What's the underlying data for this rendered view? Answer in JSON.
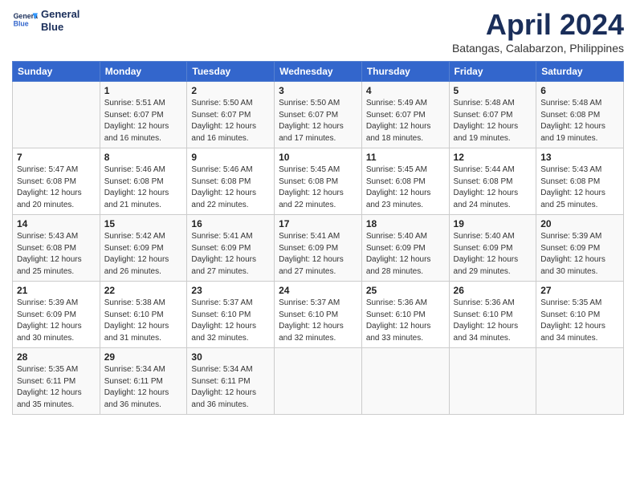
{
  "header": {
    "logo_line1": "General",
    "logo_line2": "Blue",
    "month": "April 2024",
    "location": "Batangas, Calabarzon, Philippines"
  },
  "days_of_week": [
    "Sunday",
    "Monday",
    "Tuesday",
    "Wednesday",
    "Thursday",
    "Friday",
    "Saturday"
  ],
  "weeks": [
    [
      {
        "num": "",
        "info": ""
      },
      {
        "num": "1",
        "info": "Sunrise: 5:51 AM\nSunset: 6:07 PM\nDaylight: 12 hours\nand 16 minutes."
      },
      {
        "num": "2",
        "info": "Sunrise: 5:50 AM\nSunset: 6:07 PM\nDaylight: 12 hours\nand 16 minutes."
      },
      {
        "num": "3",
        "info": "Sunrise: 5:50 AM\nSunset: 6:07 PM\nDaylight: 12 hours\nand 17 minutes."
      },
      {
        "num": "4",
        "info": "Sunrise: 5:49 AM\nSunset: 6:07 PM\nDaylight: 12 hours\nand 18 minutes."
      },
      {
        "num": "5",
        "info": "Sunrise: 5:48 AM\nSunset: 6:07 PM\nDaylight: 12 hours\nand 19 minutes."
      },
      {
        "num": "6",
        "info": "Sunrise: 5:48 AM\nSunset: 6:08 PM\nDaylight: 12 hours\nand 19 minutes."
      }
    ],
    [
      {
        "num": "7",
        "info": "Sunrise: 5:47 AM\nSunset: 6:08 PM\nDaylight: 12 hours\nand 20 minutes."
      },
      {
        "num": "8",
        "info": "Sunrise: 5:46 AM\nSunset: 6:08 PM\nDaylight: 12 hours\nand 21 minutes."
      },
      {
        "num": "9",
        "info": "Sunrise: 5:46 AM\nSunset: 6:08 PM\nDaylight: 12 hours\nand 22 minutes."
      },
      {
        "num": "10",
        "info": "Sunrise: 5:45 AM\nSunset: 6:08 PM\nDaylight: 12 hours\nand 22 minutes."
      },
      {
        "num": "11",
        "info": "Sunrise: 5:45 AM\nSunset: 6:08 PM\nDaylight: 12 hours\nand 23 minutes."
      },
      {
        "num": "12",
        "info": "Sunrise: 5:44 AM\nSunset: 6:08 PM\nDaylight: 12 hours\nand 24 minutes."
      },
      {
        "num": "13",
        "info": "Sunrise: 5:43 AM\nSunset: 6:08 PM\nDaylight: 12 hours\nand 25 minutes."
      }
    ],
    [
      {
        "num": "14",
        "info": "Sunrise: 5:43 AM\nSunset: 6:08 PM\nDaylight: 12 hours\nand 25 minutes."
      },
      {
        "num": "15",
        "info": "Sunrise: 5:42 AM\nSunset: 6:09 PM\nDaylight: 12 hours\nand 26 minutes."
      },
      {
        "num": "16",
        "info": "Sunrise: 5:41 AM\nSunset: 6:09 PM\nDaylight: 12 hours\nand 27 minutes."
      },
      {
        "num": "17",
        "info": "Sunrise: 5:41 AM\nSunset: 6:09 PM\nDaylight: 12 hours\nand 27 minutes."
      },
      {
        "num": "18",
        "info": "Sunrise: 5:40 AM\nSunset: 6:09 PM\nDaylight: 12 hours\nand 28 minutes."
      },
      {
        "num": "19",
        "info": "Sunrise: 5:40 AM\nSunset: 6:09 PM\nDaylight: 12 hours\nand 29 minutes."
      },
      {
        "num": "20",
        "info": "Sunrise: 5:39 AM\nSunset: 6:09 PM\nDaylight: 12 hours\nand 30 minutes."
      }
    ],
    [
      {
        "num": "21",
        "info": "Sunrise: 5:39 AM\nSunset: 6:09 PM\nDaylight: 12 hours\nand 30 minutes."
      },
      {
        "num": "22",
        "info": "Sunrise: 5:38 AM\nSunset: 6:10 PM\nDaylight: 12 hours\nand 31 minutes."
      },
      {
        "num": "23",
        "info": "Sunrise: 5:37 AM\nSunset: 6:10 PM\nDaylight: 12 hours\nand 32 minutes."
      },
      {
        "num": "24",
        "info": "Sunrise: 5:37 AM\nSunset: 6:10 PM\nDaylight: 12 hours\nand 32 minutes."
      },
      {
        "num": "25",
        "info": "Sunrise: 5:36 AM\nSunset: 6:10 PM\nDaylight: 12 hours\nand 33 minutes."
      },
      {
        "num": "26",
        "info": "Sunrise: 5:36 AM\nSunset: 6:10 PM\nDaylight: 12 hours\nand 34 minutes."
      },
      {
        "num": "27",
        "info": "Sunrise: 5:35 AM\nSunset: 6:10 PM\nDaylight: 12 hours\nand 34 minutes."
      }
    ],
    [
      {
        "num": "28",
        "info": "Sunrise: 5:35 AM\nSunset: 6:11 PM\nDaylight: 12 hours\nand 35 minutes."
      },
      {
        "num": "29",
        "info": "Sunrise: 5:34 AM\nSunset: 6:11 PM\nDaylight: 12 hours\nand 36 minutes."
      },
      {
        "num": "30",
        "info": "Sunrise: 5:34 AM\nSunset: 6:11 PM\nDaylight: 12 hours\nand 36 minutes."
      },
      {
        "num": "",
        "info": ""
      },
      {
        "num": "",
        "info": ""
      },
      {
        "num": "",
        "info": ""
      },
      {
        "num": "",
        "info": ""
      }
    ]
  ]
}
